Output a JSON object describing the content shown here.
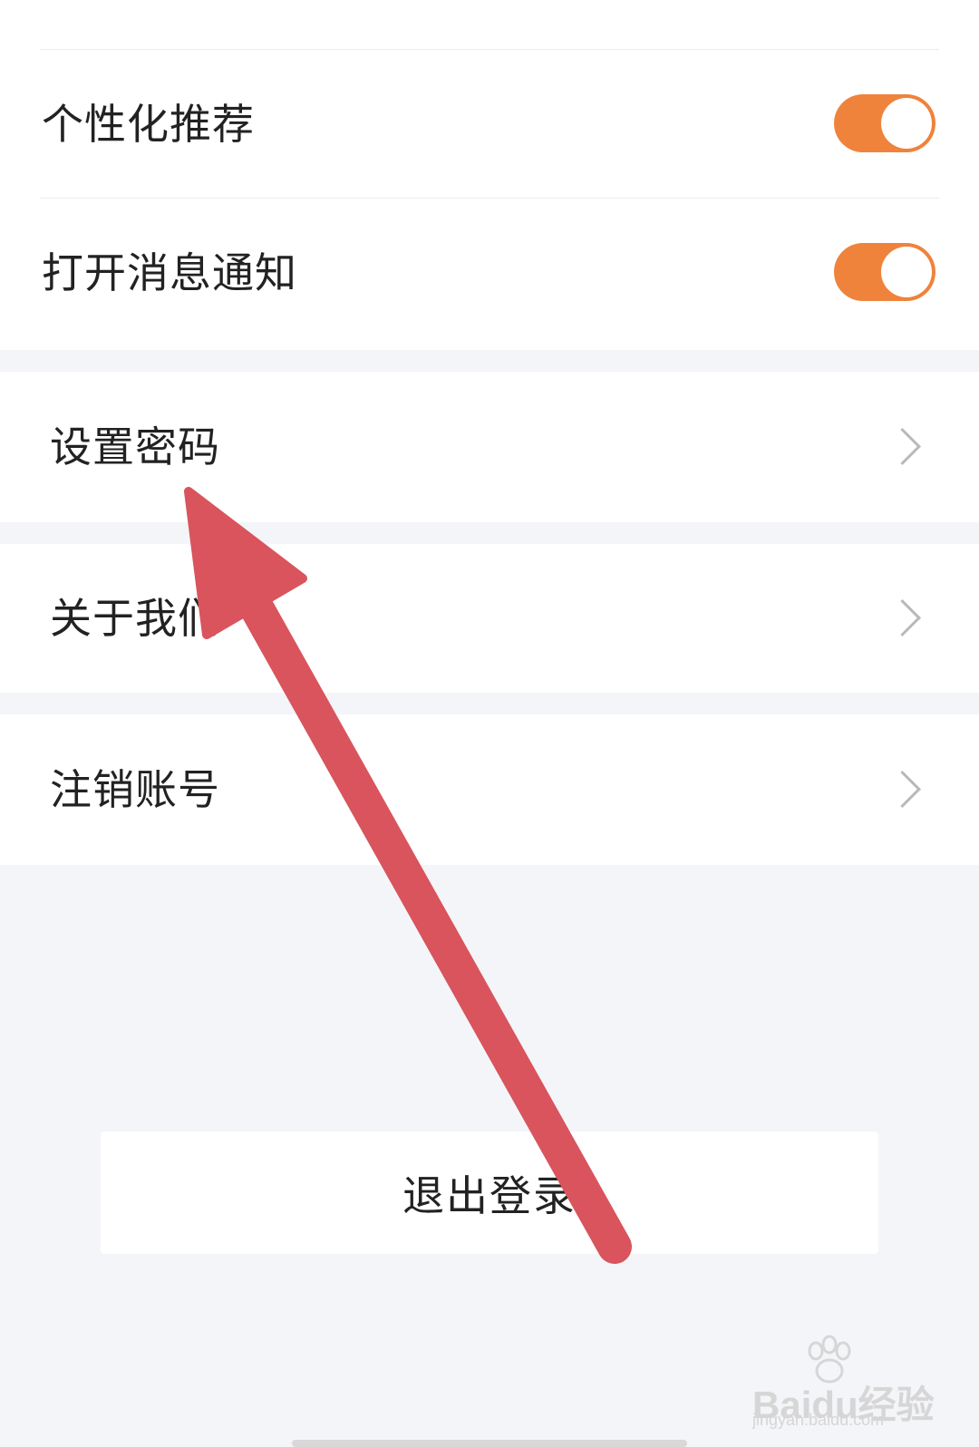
{
  "settings": {
    "personalized_recommendation": {
      "label": "个性化推荐",
      "enabled": true
    },
    "message_notifications": {
      "label": "打开消息通知",
      "enabled": true
    }
  },
  "menu": [
    {
      "label": "设置密码",
      "icon": "chevron-right-icon"
    },
    {
      "label": "关于我们",
      "icon": "chevron-right-icon"
    },
    {
      "label": "注销账号",
      "icon": "chevron-right-icon"
    }
  ],
  "logout": {
    "label": "退出登录"
  },
  "watermark": {
    "brand": "Baidu经验",
    "url": "jingyan.baidu.com"
  },
  "colors": {
    "toggle_on": "#ef833b",
    "annotation_arrow": "#d9545c",
    "page_background": "#f4f5f9"
  }
}
